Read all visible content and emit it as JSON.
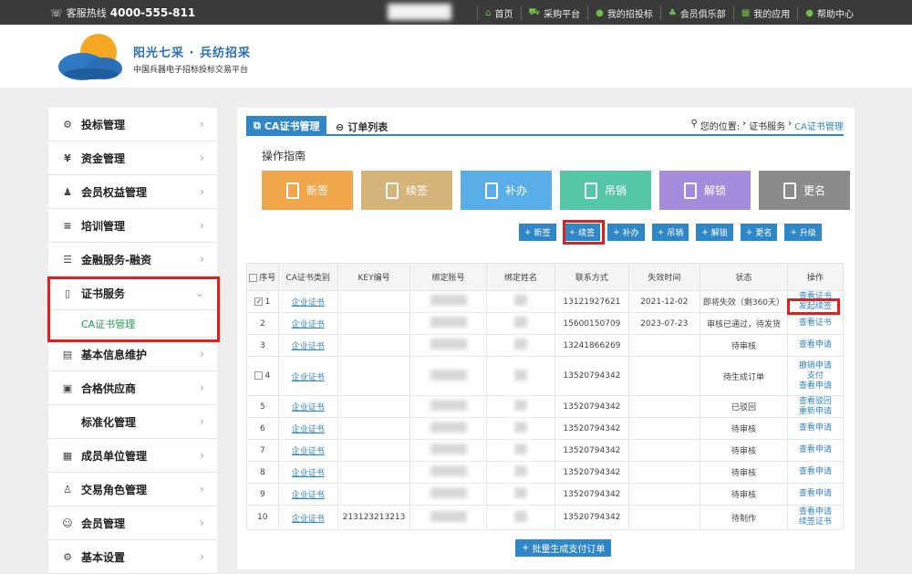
{
  "topbar": {
    "hotline_label": "客服热线",
    "hotline_number": "4000-555-811",
    "nav": [
      {
        "label": "首页",
        "icon": "home-icon"
      },
      {
        "label": "采购平台",
        "icon": "cart-icon"
      },
      {
        "label": "我的招投标",
        "icon": "user-icon"
      },
      {
        "label": "会员俱乐部",
        "icon": "members-icon"
      },
      {
        "label": "我的应用",
        "icon": "grid-icon"
      },
      {
        "label": "帮助中心",
        "icon": "help-icon"
      }
    ]
  },
  "brand": {
    "title": "阳光七采 · 兵纺招采",
    "subtitle": "中国兵器电子招标投标交易平台"
  },
  "sidebar": {
    "items": [
      {
        "label": "投标管理",
        "icon": "gear-icon"
      },
      {
        "label": "资金管理",
        "icon": "money-icon"
      },
      {
        "label": "会员权益管理",
        "icon": "people-icon"
      },
      {
        "label": "培训管理",
        "icon": "training-icon"
      },
      {
        "label": "金融服务-融资",
        "icon": "finance-icon"
      },
      {
        "label": "证书服务",
        "icon": "certificate-icon",
        "expanded": true
      },
      {
        "label": "基本信息维护",
        "icon": "info-icon"
      },
      {
        "label": "合格供应商",
        "icon": "supplier-icon"
      },
      {
        "label": "标准化管理",
        "icon": ""
      },
      {
        "label": "成员单位管理",
        "icon": "building-icon"
      },
      {
        "label": "交易角色管理",
        "icon": "role-icon"
      },
      {
        "label": "会员管理",
        "icon": "member-icon"
      },
      {
        "label": "基本设置",
        "icon": "settings-icon"
      }
    ],
    "submenu_active": "CA证书管理"
  },
  "main": {
    "tab_active": "CA证书管理",
    "tab_other": "订单列表",
    "location_label": "您的位置:",
    "location_path": "证书服务",
    "location_current": "CA证书管理",
    "guide_title": "操作指南",
    "big_buttons": [
      {
        "label": "新签",
        "color": "#f0a64a"
      },
      {
        "label": "续签",
        "color": "#d6b378"
      },
      {
        "label": "补办",
        "color": "#5aaee8"
      },
      {
        "label": "吊销",
        "color": "#55c6a6"
      },
      {
        "label": "解锁",
        "color": "#a58bdc"
      },
      {
        "label": "更名",
        "color": "#8b8b8b"
      }
    ],
    "small_buttons": [
      "新签",
      "续签",
      "补办",
      "吊销",
      "解锁",
      "更名",
      "升级"
    ],
    "table": {
      "headers": [
        "序号",
        "CA证书类别",
        "KEY编号",
        "绑定账号",
        "绑定姓名",
        "联系方式",
        "失效时间",
        "状态",
        "操作"
      ],
      "rows": [
        {
          "no": "1",
          "checked": true,
          "type": "企业证书",
          "key": "",
          "phone": "13121927621",
          "expire": "2021-12-02",
          "status": "即将失效（剩360天）",
          "ops": [
            "查看证书",
            "发起续签"
          ]
        },
        {
          "no": "2",
          "checked": false,
          "type": "企业证书",
          "key": "",
          "phone": "15600150709",
          "expire": "2023-07-23",
          "status": "审核已通过，待发货",
          "ops": [
            "查看证书"
          ]
        },
        {
          "no": "3",
          "checked": false,
          "type": "企业证书",
          "key": "",
          "phone": "13241866269",
          "expire": "",
          "status": "待审核",
          "ops": [
            "查看申请"
          ]
        },
        {
          "no": "4",
          "checked": false,
          "type": "企业证书",
          "key": "",
          "phone": "13520794342",
          "expire": "",
          "status": "待生成订单",
          "ops": [
            "撤销申请",
            "支付",
            "查看申请"
          ]
        },
        {
          "no": "5",
          "checked": false,
          "type": "企业证书",
          "key": "",
          "phone": "13520794342",
          "expire": "",
          "status": "已驳回",
          "ops": [
            "查看驳回",
            "重新申请"
          ]
        },
        {
          "no": "6",
          "checked": false,
          "type": "企业证书",
          "key": "",
          "phone": "13520794342",
          "expire": "",
          "status": "待审核",
          "ops": [
            "查看申请"
          ]
        },
        {
          "no": "7",
          "checked": false,
          "type": "企业证书",
          "key": "",
          "phone": "13520794342",
          "expire": "",
          "status": "待审核",
          "ops": [
            "查看申请"
          ]
        },
        {
          "no": "8",
          "checked": false,
          "type": "企业证书",
          "key": "",
          "phone": "13520794342",
          "expire": "",
          "status": "待审核",
          "ops": [
            "查看申请"
          ]
        },
        {
          "no": "9",
          "checked": false,
          "type": "企业证书",
          "key": "",
          "phone": "13520794342",
          "expire": "",
          "status": "待审核",
          "ops": [
            "查看申请"
          ]
        },
        {
          "no": "10",
          "checked": false,
          "type": "企业证书",
          "key": "213123213213",
          "phone": "13520794342",
          "expire": "",
          "status": "待制作",
          "ops": [
            "查看申请",
            "续签证书"
          ]
        }
      ]
    },
    "batch_button": "批量生成支付订单"
  }
}
